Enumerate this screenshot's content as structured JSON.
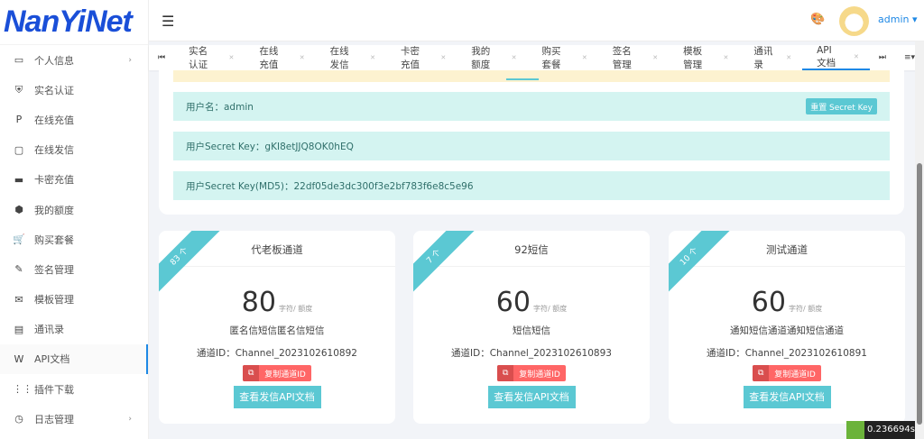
{
  "logo": "NanYiNet",
  "sidebar": {
    "items": [
      {
        "label": "个人信息",
        "icon": "id-card-icon",
        "arrow": true
      },
      {
        "label": "实名认证",
        "icon": "shield-user-icon"
      },
      {
        "label": "在线充值",
        "icon": "paypal-icon"
      },
      {
        "label": "在线发信",
        "icon": "chat-icon"
      },
      {
        "label": "卡密充值",
        "icon": "card-icon"
      },
      {
        "label": "我的额度",
        "icon": "cube-icon"
      },
      {
        "label": "购买套餐",
        "icon": "cart-icon"
      },
      {
        "label": "签名管理",
        "icon": "pen-icon"
      },
      {
        "label": "模板管理",
        "icon": "mail-check-icon"
      },
      {
        "label": "通讯录",
        "icon": "contacts-icon"
      },
      {
        "label": "API文档",
        "icon": "word-icon",
        "active": true
      },
      {
        "label": "插件下载",
        "icon": "grid-icon"
      },
      {
        "label": "日志管理",
        "icon": "calendar-clock-icon",
        "arrow": true
      }
    ]
  },
  "header": {
    "user": "admin"
  },
  "tabs": [
    "实名认证",
    "在线充值",
    "在线发信",
    "卡密充值",
    "我的额度",
    "购买套餐",
    "签名管理",
    "模板管理",
    "通讯录",
    "API文档"
  ],
  "account": {
    "username": "用户名：admin",
    "reset_label": "重置 Secret Key",
    "secret": "用户Secret Key：gKI8etJJQ8OK0hEQ",
    "secret_md5": "用户Secret Key(MD5)：22df05de3dc300f3e2bf783f6e8c5e96"
  },
  "channels": [
    {
      "ribbon": "83 个",
      "title": "代老板通道",
      "count": "80",
      "unit": "字符/ 额度",
      "desc": "匿名信短信匿名信短信",
      "id": "通道ID：Channel_2023102610892"
    },
    {
      "ribbon": "7 个",
      "title": "92短信",
      "count": "60",
      "unit": "字符/ 额度",
      "desc": "短信短信",
      "id": "通道ID：Channel_2023102610893"
    },
    {
      "ribbon": "10 个",
      "title": "测试通道",
      "count": "60",
      "unit": "字符/ 额度",
      "desc": "通知短信通道通知短信通道",
      "id": "通道ID：Channel_2023102610891"
    }
  ],
  "copy_label": "复制通道ID",
  "doc_label": "查看发信API文档",
  "timer": "0.236694s",
  "colors": {
    "accent": "#5bc8d3",
    "danger": "#ff6666",
    "link": "#1e88e5"
  }
}
